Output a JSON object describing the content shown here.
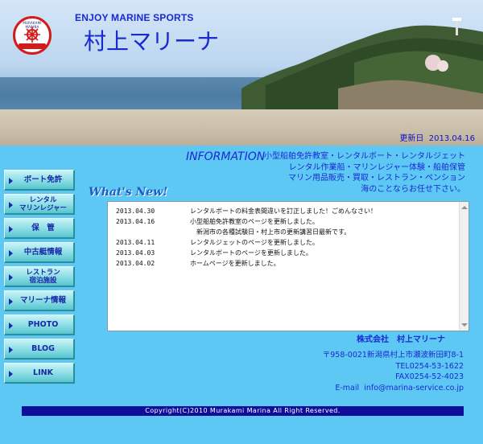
{
  "header": {
    "tagline": "ENJOY MARINE SPORTS",
    "brand": "村上マリーナ",
    "updated_label": "更新日",
    "updated_date": "2013.04.16",
    "logo_text": "MURAKAMI MARINA"
  },
  "info": {
    "title": "INFORMATION",
    "services": [
      "小型船舶免許教室・レンタルボート・レンタルジェット",
      "レンタル作業船・マリンレジャー体験・船舶保管",
      "マリン用品販売・買取・レストラン・ペンション",
      "海のことならお任せ下さい。"
    ]
  },
  "nav": [
    {
      "label": "ボート免許"
    },
    {
      "label": "レンタル\nマリンレジャー"
    },
    {
      "label": "保　管"
    },
    {
      "label": "中古艇情報"
    },
    {
      "label": "レストラン\n宿泊施設"
    },
    {
      "label": "マリーナ情報"
    },
    {
      "label": "PHOTO"
    },
    {
      "label": "BLOG"
    },
    {
      "label": "LINK"
    }
  ],
  "whats_new": {
    "title": "What's New!",
    "items": [
      {
        "date": "2013.04.30",
        "text": "レンタルボートの料金表間違いを訂正しました！ごめんなさい！"
      },
      {
        "date": "2013.04.16",
        "text": "小型船舶免許教室のページを更新しました。"
      },
      {
        "date": "",
        "text": "　新潟市の各種試験日・村上市の更新講習日最新です。"
      },
      {
        "date": "2013.04.11",
        "text": "レンタルジェットのページを更新しました。"
      },
      {
        "date": "2013.04.03",
        "text": "レンタルボートのページを更新しました。"
      },
      {
        "date": "2013.04.02",
        "text": "ホームページを更新しました。"
      }
    ]
  },
  "company": {
    "name": "株式会社　村上マリーナ",
    "address": "〒958-0021新潟県村上市瀬波新田町8-1",
    "tel": "TEL0254-53-1622",
    "fax": "FAX0254-52-4023",
    "email": "E-mail  info@marina-service.co.jp"
  },
  "footer": {
    "copyright": "Copyright(C)2010 Murakami Marina All Right Reserved."
  }
}
